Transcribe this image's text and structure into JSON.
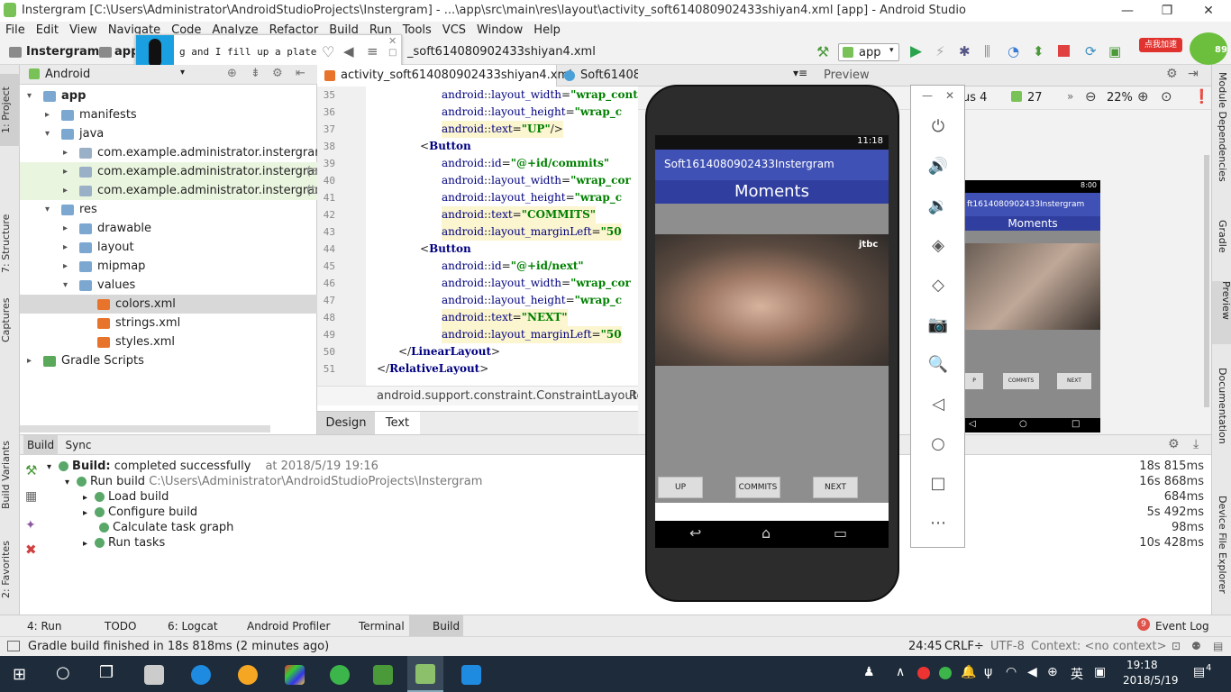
{
  "window": {
    "title": "Instergram [C:\\Users\\Administrator\\AndroidStudioProjects\\Instergram] - ...\\app\\src\\main\\res\\layout\\activity_soft614080902433shiyan4.xml [app] - Android Studio",
    "min": "—",
    "max": "❐",
    "close": "✕"
  },
  "menu": [
    "File",
    "Edit",
    "View",
    "Navigate",
    "Code",
    "Analyze",
    "Refactor",
    "Build",
    "Run",
    "Tools",
    "VCS",
    "Window",
    "Help"
  ],
  "nav": {
    "project": "Instergram",
    "module": "app",
    "file_crumb": "_soft614080902433shiyan4.xml",
    "run_config": "app",
    "badge": "点我加速",
    "badge_num": "89"
  },
  "popup": {
    "text": "g and I fill up a plate"
  },
  "left_tabs": [
    "1: Project",
    "7: Structure",
    "Captures",
    "Build Variants",
    "2: Favorites"
  ],
  "right_tabs": [
    "Module Dependencies",
    "Gradle",
    "Preview",
    "Documentation",
    "Device File Explorer"
  ],
  "project": {
    "header": "Android",
    "tree": [
      {
        "label": "app",
        "level": 0,
        "arrow": "▾",
        "icon": "folder"
      },
      {
        "label": "manifests",
        "level": 1,
        "arrow": "▸",
        "icon": "folder"
      },
      {
        "label": "java",
        "level": 1,
        "arrow": "▾",
        "icon": "folder"
      },
      {
        "label": "com.example.administrator.instergram",
        "level": 2,
        "arrow": "▸",
        "icon": "package"
      },
      {
        "label": "com.example.administrator.instergram",
        "suffix": "(and",
        "level": 2,
        "arrow": "▸",
        "icon": "package"
      },
      {
        "label": "com.example.administrator.instergram",
        "suffix": "(tes",
        "level": 2,
        "arrow": "▸",
        "icon": "package"
      },
      {
        "label": "res",
        "level": 1,
        "arrow": "▾",
        "icon": "folder"
      },
      {
        "label": "drawable",
        "level": 2,
        "arrow": "▸",
        "icon": "folder"
      },
      {
        "label": "layout",
        "level": 2,
        "arrow": "▸",
        "icon": "folder"
      },
      {
        "label": "mipmap",
        "level": 2,
        "arrow": "▸",
        "icon": "folder"
      },
      {
        "label": "values",
        "level": 2,
        "arrow": "▾",
        "icon": "folder"
      },
      {
        "label": "colors.xml",
        "level": 3,
        "arrow": "",
        "icon": "xml"
      },
      {
        "label": "strings.xml",
        "level": 3,
        "arrow": "",
        "icon": "xml"
      },
      {
        "label": "styles.xml",
        "level": 3,
        "arrow": "",
        "icon": "xml"
      },
      {
        "label": "Gradle Scripts",
        "level": 0,
        "arrow": "▸",
        "icon": "gradle"
      }
    ]
  },
  "editor": {
    "tab1": "activity_soft614080902433shiyan4.xml",
    "tab2": "Soft614080902433shiyan4.java",
    "preview_label": "Preview",
    "lines": [
      {
        "n": "35",
        "indent": 3,
        "parts": [
          [
            "at",
            "android"
          ],
          [
            "",
            "::"
          ],
          [
            "at",
            "layout_width"
          ],
          [
            "",
            "="
          ],
          [
            "str",
            "\"wrap_cont"
          ]
        ]
      },
      {
        "n": "36",
        "indent": 3,
        "parts": [
          [
            "at",
            "android"
          ],
          [
            "",
            "::"
          ],
          [
            "at",
            "layout_height"
          ],
          [
            "",
            "="
          ],
          [
            "str",
            "\"wrap_c"
          ]
        ]
      },
      {
        "n": "37",
        "indent": 3,
        "hl": true,
        "parts": [
          [
            "at",
            "android"
          ],
          [
            "",
            "::"
          ],
          [
            "at",
            "text"
          ],
          [
            "",
            "="
          ],
          [
            "str",
            "\"UP\""
          ],
          [
            "",
            "/>"
          ]
        ]
      },
      {
        "n": "38",
        "indent": 2,
        "parts": [
          [
            "",
            "<"
          ],
          [
            "kw",
            "Button"
          ]
        ]
      },
      {
        "n": "39",
        "indent": 3,
        "parts": [
          [
            "at",
            "android"
          ],
          [
            "",
            "::"
          ],
          [
            "at",
            "id"
          ],
          [
            "",
            "="
          ],
          [
            "str",
            "\"@+id/commits\""
          ]
        ]
      },
      {
        "n": "40",
        "indent": 3,
        "parts": [
          [
            "at",
            "android"
          ],
          [
            "",
            "::"
          ],
          [
            "at",
            "layout_width"
          ],
          [
            "",
            "="
          ],
          [
            "str",
            "\"wrap_cor"
          ]
        ]
      },
      {
        "n": "41",
        "indent": 3,
        "parts": [
          [
            "at",
            "android"
          ],
          [
            "",
            "::"
          ],
          [
            "at",
            "layout_height"
          ],
          [
            "",
            "="
          ],
          [
            "str",
            "\"wrap_c"
          ]
        ]
      },
      {
        "n": "42",
        "indent": 3,
        "hl": true,
        "parts": [
          [
            "at",
            "android"
          ],
          [
            "",
            "::"
          ],
          [
            "at",
            "text"
          ],
          [
            "",
            "="
          ],
          [
            "str",
            "\"COMMITS\""
          ]
        ]
      },
      {
        "n": "43",
        "indent": 3,
        "hl": true,
        "parts": [
          [
            "at",
            "android"
          ],
          [
            "",
            "::"
          ],
          [
            "at",
            "layout_marginLeft"
          ],
          [
            "",
            "="
          ],
          [
            "str",
            "\"50"
          ]
        ]
      },
      {
        "n": "44",
        "indent": 2,
        "parts": [
          [
            "",
            "<"
          ],
          [
            "kw",
            "Button"
          ]
        ]
      },
      {
        "n": "45",
        "indent": 3,
        "parts": [
          [
            "at",
            "android"
          ],
          [
            "",
            "::"
          ],
          [
            "at",
            "id"
          ],
          [
            "",
            "="
          ],
          [
            "str",
            "\"@+id/next\""
          ]
        ]
      },
      {
        "n": "46",
        "indent": 3,
        "parts": [
          [
            "at",
            "android"
          ],
          [
            "",
            "::"
          ],
          [
            "at",
            "layout_width"
          ],
          [
            "",
            "="
          ],
          [
            "str",
            "\"wrap_cor"
          ]
        ]
      },
      {
        "n": "47",
        "indent": 3,
        "parts": [
          [
            "at",
            "android"
          ],
          [
            "",
            "::"
          ],
          [
            "at",
            "layout_height"
          ],
          [
            "",
            "="
          ],
          [
            "str",
            "\"wrap_c"
          ]
        ]
      },
      {
        "n": "48",
        "indent": 3,
        "hl": true,
        "parts": [
          [
            "at",
            "android"
          ],
          [
            "",
            "::"
          ],
          [
            "at",
            "text"
          ],
          [
            "",
            "="
          ],
          [
            "str",
            "\"NEXT\""
          ]
        ]
      },
      {
        "n": "49",
        "indent": 3,
        "hl": true,
        "parts": [
          [
            "at",
            "android"
          ],
          [
            "",
            "::"
          ],
          [
            "at",
            "layout_marginLeft"
          ],
          [
            "",
            "="
          ],
          [
            "str",
            "\"50"
          ]
        ]
      },
      {
        "n": "50",
        "indent": 1,
        "parts": [
          [
            "",
            "</"
          ],
          [
            "kw",
            "LinearLayout"
          ],
          [
            "",
            ">"
          ]
        ]
      },
      {
        "n": "51",
        "indent": 0,
        "parts": [
          [
            "",
            "</"
          ],
          [
            "kw",
            "RelativeLayout"
          ],
          [
            "",
            ">"
          ]
        ]
      }
    ],
    "breadcrumb": "android.support.constraint.ConstraintLayout",
    "breadcrumb2": "Rel",
    "design_tab": "Design",
    "text_tab": "Text"
  },
  "preview": {
    "api": "us 4",
    "level": "27",
    "zoom": "22%",
    "time": "8:00",
    "app_title": "ft1614080902433Instergram",
    "header": "Moments",
    "buttons": [
      "P",
      "COMMITS",
      "NEXT"
    ]
  },
  "emulator": {
    "time": "11:18",
    "app_title": "Soft1614080902433Instergram",
    "header": "Moments",
    "photo_tag": "jtbc",
    "buttons": [
      "UP",
      "COMMITS",
      "NEXT"
    ],
    "primary_color": "#3f51b5",
    "header_color": "#303f9f"
  },
  "emu_sidebar": {
    "icons": [
      "power-icon",
      "volume-up-icon",
      "volume-down-icon",
      "rotate-left-icon",
      "rotate-right-icon",
      "camera-icon",
      "zoom-icon",
      "back-icon",
      "home-icon",
      "overview-icon",
      "more-icon"
    ],
    "glyphs": [
      "⏻",
      "🔊",
      "🔉",
      "◈",
      "◇",
      "📷",
      "🔍",
      "◁",
      "○",
      "□",
      "⋯"
    ]
  },
  "build": {
    "tab_build": "Build",
    "tab_sync": "Sync",
    "rows": [
      {
        "label": "Build:",
        "rest": " completed successfully",
        "date": "at 2018/5/19 19:16",
        "time": "18s 815ms",
        "level": 0,
        "arrow": "▾"
      },
      {
        "label": "Run build",
        "rest": " C:\\Users\\Administrator\\AndroidStudioProjects\\Instergram",
        "date": "",
        "time": "16s 868ms",
        "level": 1,
        "arrow": "▾"
      },
      {
        "label": "Load build",
        "rest": "",
        "date": "",
        "time": "684ms",
        "level": 2,
        "arrow": "▸"
      },
      {
        "label": "Configure build",
        "rest": "",
        "date": "",
        "time": "5s 492ms",
        "level": 2,
        "arrow": "▸"
      },
      {
        "label": "Calculate task graph",
        "rest": "",
        "date": "",
        "time": "98ms",
        "level": 2,
        "arrow": ""
      },
      {
        "label": "Run tasks",
        "rest": "",
        "date": "",
        "time": "10s 428ms",
        "level": 2,
        "arrow": "▸"
      }
    ]
  },
  "bottom_tabs": [
    "4: Run",
    "TODO",
    "6: Logcat",
    "Android Profiler",
    "Terminal",
    "Build"
  ],
  "event_log": "Event Log",
  "event_count": "9",
  "status": {
    "message": "Gradle build finished in 18s 818ms (2 minutes ago)",
    "position": "24:45",
    "line_sep": "CRLF÷",
    "encoding": "UTF-8",
    "context": "Context: <no context>"
  },
  "taskbar": {
    "time": "19:18",
    "date": "2018/5/19",
    "lang": "英",
    "notif": "4"
  }
}
